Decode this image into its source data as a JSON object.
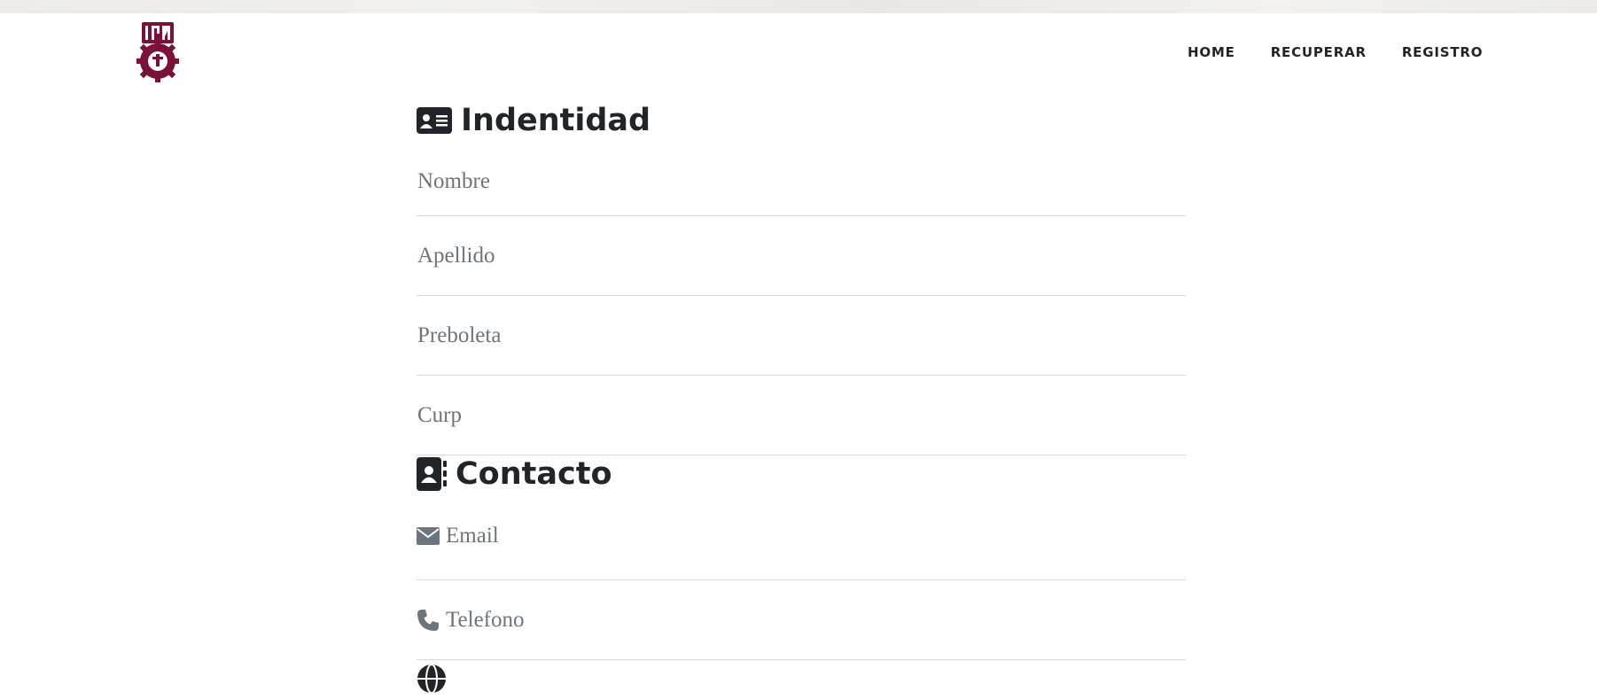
{
  "nav": {
    "logo_alt": "IPN",
    "links": [
      "HOME",
      "RECUPERAR",
      "REGISTRO"
    ]
  },
  "sections": {
    "identidad": {
      "title": "Indentidad",
      "icon": "id-card-icon",
      "fields": {
        "nombre": {
          "placeholder": "Nombre",
          "value": ""
        },
        "apellido": {
          "placeholder": "Apellido",
          "value": ""
        },
        "preboleta": {
          "placeholder": "Preboleta",
          "value": ""
        },
        "curp": {
          "placeholder": "Curp",
          "value": ""
        }
      }
    },
    "contacto": {
      "title": "Contacto",
      "icon": "address-book-icon",
      "fields": {
        "email": {
          "placeholder": "Email",
          "icon": "envelope-icon",
          "value": ""
        },
        "telefono": {
          "placeholder": "Telefono",
          "icon": "phone-icon",
          "value": ""
        }
      }
    },
    "next": {
      "icon": "globe-icon"
    }
  },
  "colors": {
    "brand": "#7b1138",
    "text_dark": "#212529",
    "placeholder": "#6c757d",
    "divider": "#d9d9d9"
  }
}
